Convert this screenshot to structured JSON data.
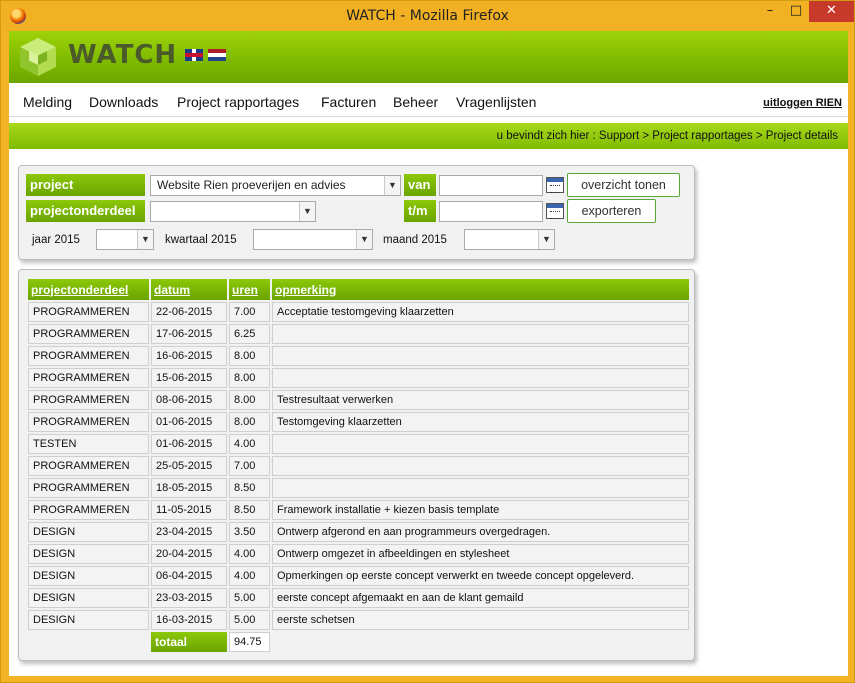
{
  "window": {
    "title": "WATCH - Mozilla Firefox",
    "min": "–",
    "max": "□",
    "close": "✕"
  },
  "brand": {
    "name": "WATCH"
  },
  "nav": {
    "items": [
      "Melding",
      "Downloads",
      "Project rapportages",
      "Facturen",
      "Beheer",
      "Vragenlijsten"
    ],
    "logout": "uitloggen RIEN"
  },
  "breadcrumb": "u bevindt zich hier : Support > Project rapportages > Project details",
  "filters": {
    "project_label": "project",
    "project_value": "Website Rien proeverijen en advies",
    "sub_label": "projectonderdeel",
    "sub_value": "",
    "van_label": "van",
    "tm_label": "t/m",
    "van_value": "",
    "tm_value": "",
    "btn_overview": "overzicht tonen",
    "btn_export": "exporteren",
    "jaar_label": "jaar 2015",
    "kwartaal_label": "kwartaal 2015",
    "maand_label": "maand 2015"
  },
  "table": {
    "headers": [
      "projectonderdeel",
      "datum",
      "uren",
      "opmerking"
    ],
    "rows": [
      [
        "PROGRAMMEREN",
        "22-06-2015",
        "7.00",
        "Acceptatie testomgeving klaarzetten"
      ],
      [
        "PROGRAMMEREN",
        "17-06-2015",
        "6.25",
        ""
      ],
      [
        "PROGRAMMEREN",
        "16-06-2015",
        "8.00",
        ""
      ],
      [
        "PROGRAMMEREN",
        "15-06-2015",
        "8.00",
        ""
      ],
      [
        "PROGRAMMEREN",
        "08-06-2015",
        "8.00",
        "Testresultaat verwerken"
      ],
      [
        "PROGRAMMEREN",
        "01-06-2015",
        "8.00",
        "Testomgeving klaarzetten"
      ],
      [
        "TESTEN",
        "01-06-2015",
        "4.00",
        ""
      ],
      [
        "PROGRAMMEREN",
        "25-05-2015",
        "7.00",
        ""
      ],
      [
        "PROGRAMMEREN",
        "18-05-2015",
        "8.50",
        ""
      ],
      [
        "PROGRAMMEREN",
        "11-05-2015",
        "8.50",
        "Framework installatie + kiezen basis template"
      ],
      [
        "DESIGN",
        "23-04-2015",
        "3.50",
        "Ontwerp afgerond en aan programmeurs overgedragen."
      ],
      [
        "DESIGN",
        "20-04-2015",
        "4.00",
        "Ontwerp omgezet in afbeeldingen en stylesheet"
      ],
      [
        "DESIGN",
        "06-04-2015",
        "4.00",
        "Opmerkingen op eerste concept verwerkt en tweede concept opgeleverd."
      ],
      [
        "DESIGN",
        "23-03-2015",
        "5.00",
        "eerste concept afgemaakt en aan de klant gemaild"
      ],
      [
        "DESIGN",
        "16-03-2015",
        "5.00",
        "eerste schetsen"
      ]
    ],
    "total_label": "totaal",
    "total_value": "94.75"
  },
  "colors": {
    "accent_green": "#7db900",
    "window_frame": "#f2b023",
    "close_red": "#c7392b"
  },
  "icons": [
    "firefox-icon",
    "logo-cube-icon",
    "flag-uk-icon",
    "flag-nl-icon",
    "calendar-icon",
    "chevron-down-icon"
  ]
}
